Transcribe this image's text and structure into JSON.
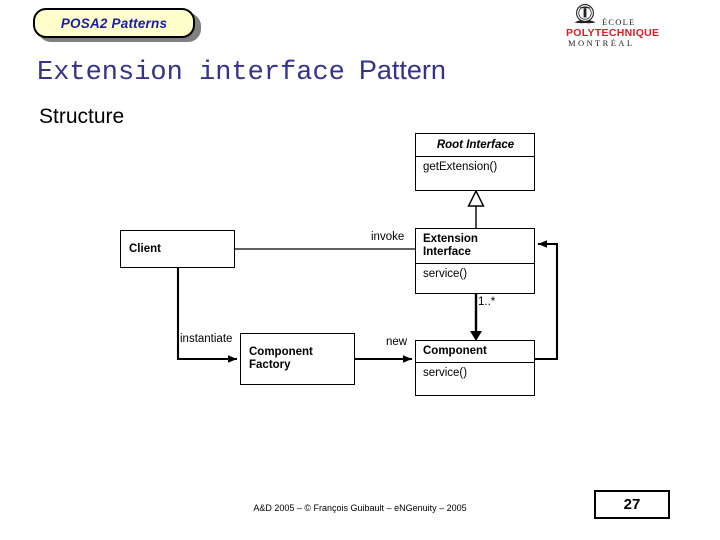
{
  "banner": {
    "label": "POSA2 Patterns",
    "fill_color": "#ffffcc",
    "text_color": "#1a1aad",
    "shadow_color": "#808080"
  },
  "logo": {
    "crest_alt": "polytechnique-crest-icon",
    "line1": "ÉCOLE",
    "line2": "POLYTECHNIQUE",
    "line3": "MONTRÉAL",
    "accent_color": "#d42027"
  },
  "title": {
    "mono_part": "Extension interface",
    "sans_part": "Pattern",
    "color": "#33338c",
    "subtitle": "Structure"
  },
  "diagram": {
    "type": "uml-class-diagram",
    "classes": [
      {
        "id": "root-interface",
        "name": "Root Interface",
        "abstract": true,
        "operations": [
          "getExtension()"
        ]
      },
      {
        "id": "extension-interface",
        "name": "Extension\nInterface",
        "name_line1": "Extension",
        "name_line2": "Interface",
        "abstract": false,
        "operations": [
          "service()"
        ]
      },
      {
        "id": "client",
        "name": "Client",
        "abstract": false,
        "operations": []
      },
      {
        "id": "component-factory",
        "name": "Component\nFactory",
        "name_line1": "Component",
        "name_line2": "Factory",
        "abstract": false,
        "operations": []
      },
      {
        "id": "component",
        "name": "Component",
        "abstract": false,
        "operations": [
          "service()"
        ]
      }
    ],
    "relations": [
      {
        "id": "inherit",
        "from": "extension-interface",
        "to": "root-interface",
        "kind": "generalization",
        "label": ""
      },
      {
        "id": "invoke",
        "from": "client",
        "to": "extension-interface",
        "kind": "association",
        "label": "invoke"
      },
      {
        "id": "instantiate",
        "from": "client",
        "to": "component-factory",
        "kind": "directed-association",
        "label": "instantiate"
      },
      {
        "id": "new",
        "from": "component-factory",
        "to": "component",
        "kind": "directed-association",
        "label": "new"
      },
      {
        "id": "owns",
        "from": "extension-interface",
        "to": "component",
        "kind": "composition",
        "label": "1..*"
      },
      {
        "id": "implements",
        "from": "component",
        "to": "extension-interface",
        "kind": "directed-association",
        "label": ""
      }
    ],
    "multiplicity": "1..*"
  },
  "footer": {
    "credit": "A&D 2005 – ©  François Guibault – eNGenuity – 2005",
    "page_number": "27"
  }
}
